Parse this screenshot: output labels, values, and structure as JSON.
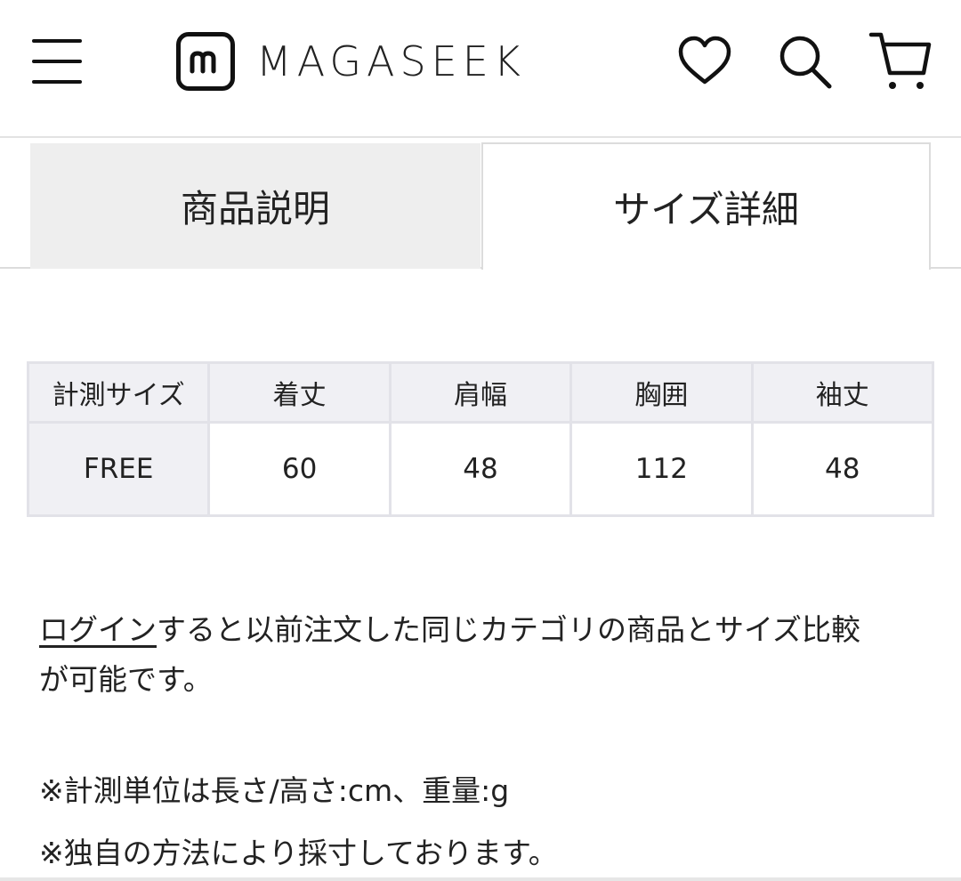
{
  "header": {
    "brand_name": "MAGASEEK",
    "icons": [
      "menu-icon",
      "logo-icon",
      "heart-icon",
      "search-icon",
      "cart-icon"
    ]
  },
  "tabs": [
    {
      "label": "商品説明",
      "active": false
    },
    {
      "label": "サイズ詳細",
      "active": true
    }
  ],
  "size_table": {
    "headers": [
      "計測サイズ",
      "着丈",
      "肩幅",
      "胸囲",
      "袖丈"
    ],
    "rows": [
      [
        "FREE",
        "60",
        "48",
        "112",
        "48"
      ]
    ]
  },
  "notes": {
    "login_link": "ログイン",
    "login_text_line1": "すると以前注文した同じカテゴリの商品とサイズ比較",
    "login_text_line2": "が可能です。",
    "units": "※計測単位は長さ/高さ:cm、重量:g",
    "method": "※独自の方法により採寸しております。"
  },
  "colors": {
    "inactive_tab_bg": "#eeeeee",
    "table_header_bg": "#f0f0f4",
    "border": "#e2e2e8",
    "text": "#222222"
  }
}
